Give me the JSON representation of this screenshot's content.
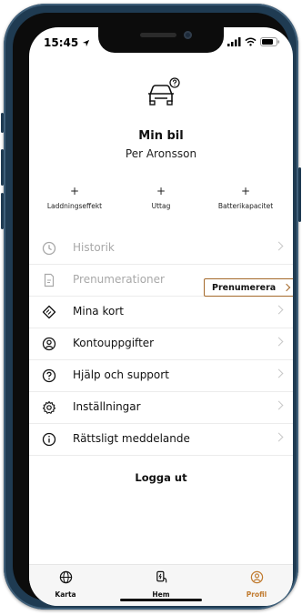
{
  "status_bar": {
    "time": "15:45"
  },
  "profile": {
    "title": "Min bil",
    "name": "Per Aronsson"
  },
  "add_items": [
    {
      "plus": "+",
      "label": "Laddningseffekt"
    },
    {
      "plus": "+",
      "label": "Uttag"
    },
    {
      "plus": "+",
      "label": "Batterikapacitet"
    }
  ],
  "menu": [
    {
      "label": "Historik",
      "icon": "clock-icon",
      "disabled": true
    },
    {
      "label": "Prenumerationer",
      "icon": "document-icon",
      "disabled": true
    },
    {
      "label": "Mina kort",
      "icon": "card-icon",
      "disabled": false
    },
    {
      "label": "Kontouppgifter",
      "icon": "user-icon",
      "disabled": false
    },
    {
      "label": "Hjälp och support",
      "icon": "help-icon",
      "disabled": false
    },
    {
      "label": "Inställningar",
      "icon": "gear-icon",
      "disabled": false
    },
    {
      "label": "Rättsligt meddelande",
      "icon": "info-icon",
      "disabled": false
    }
  ],
  "subscribe_button": "Prenumerera",
  "logout": "Logga ut",
  "bottom_nav": [
    {
      "label": "Karta",
      "icon": "globe-icon",
      "active": false
    },
    {
      "label": "Hem",
      "icon": "charger-icon",
      "active": false
    },
    {
      "label": "Profil",
      "icon": "profile-icon",
      "active": true
    }
  ],
  "colors": {
    "accent": "#c07a2e",
    "disabled_text": "#a8a8a8",
    "frame": "#1f3b52"
  }
}
